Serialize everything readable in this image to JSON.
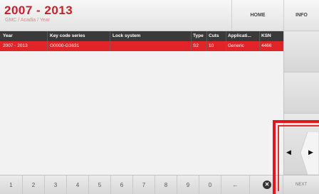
{
  "header": {
    "title": "2007 - 2013",
    "breadcrumb": "GMC / Acadia / Year",
    "home_label": "HOME",
    "info_label": "INFO"
  },
  "table": {
    "columns": [
      "Year",
      "Key code series",
      "Lock system",
      "Type",
      "Cuts",
      "Applicati...",
      "KSN"
    ],
    "rows": [
      {
        "year": "2007 - 2013",
        "key_code_series": "G0000-G3631",
        "lock_system": "",
        "type": "S2",
        "cuts": "10",
        "application": "Generic",
        "ksn": "4466",
        "selected": true
      }
    ]
  },
  "keypad": {
    "keys": [
      "1",
      "2",
      "3",
      "4",
      "5",
      "6",
      "7",
      "8",
      "9",
      "0",
      "←"
    ],
    "clear_label": "✕"
  },
  "nav": {
    "prev_symbol": "◀",
    "next_symbol": "▶",
    "next_label": "NEXT"
  },
  "colors": {
    "accent": "#c8202a",
    "selected_row": "#e02428",
    "header_bg": "#3a3a3a",
    "highlight_frame": "#e3161c"
  }
}
